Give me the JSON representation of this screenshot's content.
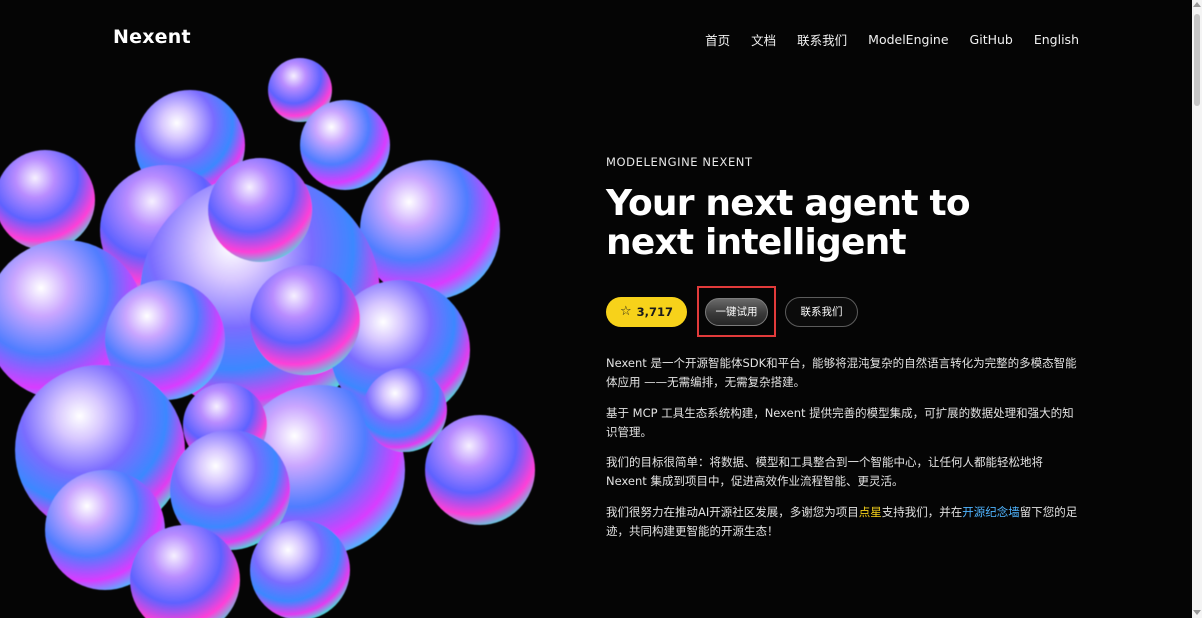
{
  "brand": "Nexent",
  "nav": [
    "首页",
    "文档",
    "联系我们",
    "ModelEngine",
    "GitHub",
    "English"
  ],
  "hero": {
    "eyebrow": "MODELENGINE NEXENT",
    "headline_line1": "Your next agent to",
    "headline_line2": "next intelligent",
    "star_count": "3,717",
    "try_label": "一键试用",
    "contact_label": "联系我们"
  },
  "paragraphs": {
    "p1": "Nexent 是一个开源智能体SDK和平台，能够将混沌复杂的自然语言转化为完整的多模态智能体应用 ——无需编排，无需复杂搭建。",
    "p2": "基于 MCP 工具生态系统构建，Nexent 提供完善的模型集成，可扩展的数据处理和强大的知识管理。",
    "p3": "我们的目标很简单：将数据、模型和工具整合到一个智能中心，让任何人都能轻松地将 Nexent 集成到项目中，促进高效作业流程智能、更灵活。",
    "p4_a": "我们很努力在推动AI开源社区发展，多谢您为项目",
    "p4_star": "点星",
    "p4_b": "支持我们，并在",
    "p4_wall": "开源纪念墙",
    "p4_c": "留下您的足迹，共同构建更智能的开源生态！"
  },
  "colors": {
    "background": "#050505",
    "star_button": "#f7d21a",
    "highlight_yellow": "#f7d21a",
    "highlight_blue": "#4fb4ff",
    "annotation_red": "#e23b3b"
  },
  "icons": {
    "star": "star-outline-icon",
    "art": "3d-blobs-illustration"
  }
}
